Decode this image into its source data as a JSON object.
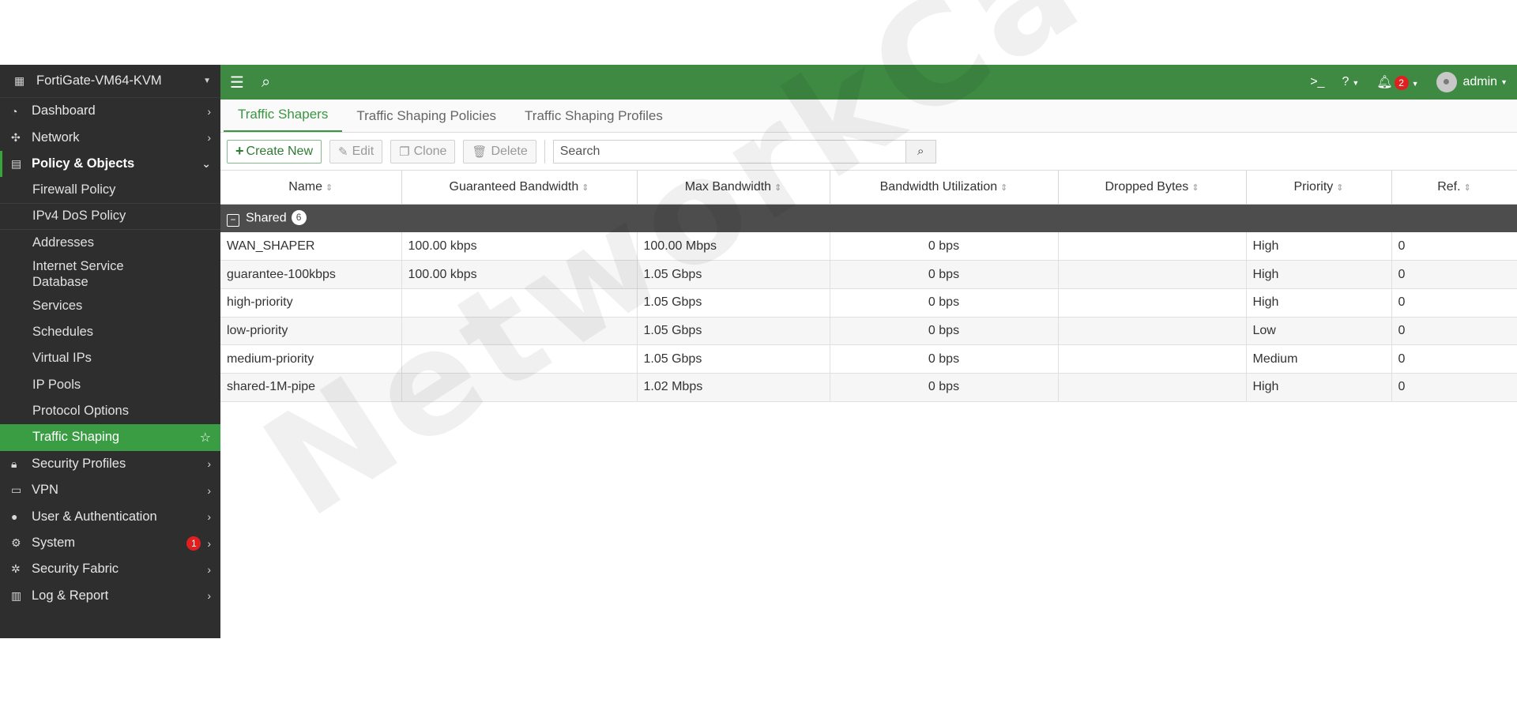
{
  "device": {
    "name": "FortiGate-VM64-KVM"
  },
  "sidebar": {
    "items": [
      {
        "label": "Dashboard"
      },
      {
        "label": "Network"
      },
      {
        "label": "Policy & Objects"
      }
    ],
    "policy_sub": [
      {
        "label": "Firewall Policy"
      },
      {
        "label": "IPv4 DoS Policy"
      },
      {
        "label": "Addresses"
      },
      {
        "label": "Internet Service Database"
      },
      {
        "label": "Services"
      },
      {
        "label": "Schedules"
      },
      {
        "label": "Virtual IPs"
      },
      {
        "label": "IP Pools"
      },
      {
        "label": "Protocol Options"
      },
      {
        "label": "Traffic Shaping"
      }
    ],
    "lower": [
      {
        "label": "Security Profiles"
      },
      {
        "label": "VPN"
      },
      {
        "label": "User & Authentication"
      },
      {
        "label": "System",
        "badge": "1"
      },
      {
        "label": "Security Fabric"
      },
      {
        "label": "Log & Report"
      }
    ]
  },
  "topbar": {
    "notifications": "2",
    "user": "admin"
  },
  "tabs": [
    {
      "label": "Traffic Shapers"
    },
    {
      "label": "Traffic Shaping Policies"
    },
    {
      "label": "Traffic Shaping Profiles"
    }
  ],
  "toolbar": {
    "create_new": "Create New",
    "edit": "Edit",
    "clone": "Clone",
    "delete": "Delete",
    "search_placeholder": "Search"
  },
  "table": {
    "columns": [
      "Name",
      "Guaranteed Bandwidth",
      "Max Bandwidth",
      "Bandwidth Utilization",
      "Dropped Bytes",
      "Priority",
      "Ref."
    ],
    "group": {
      "label": "Shared",
      "count": "6"
    },
    "rows": [
      {
        "name": "WAN_SHAPER",
        "guaranteed": "100.00 kbps",
        "max": "100.00 Mbps",
        "utilization": "0 bps",
        "dropped": "",
        "priority": "High",
        "ref": "0"
      },
      {
        "name": "guarantee-100kbps",
        "guaranteed": "100.00 kbps",
        "max": "1.05 Gbps",
        "utilization": "0 bps",
        "dropped": "",
        "priority": "High",
        "ref": "0"
      },
      {
        "name": "high-priority",
        "guaranteed": "",
        "max": "1.05 Gbps",
        "utilization": "0 bps",
        "dropped": "",
        "priority": "High",
        "ref": "0"
      },
      {
        "name": "low-priority",
        "guaranteed": "",
        "max": "1.05 Gbps",
        "utilization": "0 bps",
        "dropped": "",
        "priority": "Low",
        "ref": "0"
      },
      {
        "name": "medium-priority",
        "guaranteed": "",
        "max": "1.05 Gbps",
        "utilization": "0 bps",
        "dropped": "",
        "priority": "Medium",
        "ref": "0"
      },
      {
        "name": "shared-1M-pipe",
        "guaranteed": "",
        "max": "1.02 Mbps",
        "utilization": "0 bps",
        "dropped": "",
        "priority": "High",
        "ref": "0"
      }
    ]
  },
  "watermark": "NetworkCat",
  "colors": {
    "accent": "#3e8a43",
    "sidebar_bg": "#2e2e2e",
    "active_item": "#3b9d43",
    "badge": "#e02020",
    "ref_link": "#2a6fd0"
  }
}
